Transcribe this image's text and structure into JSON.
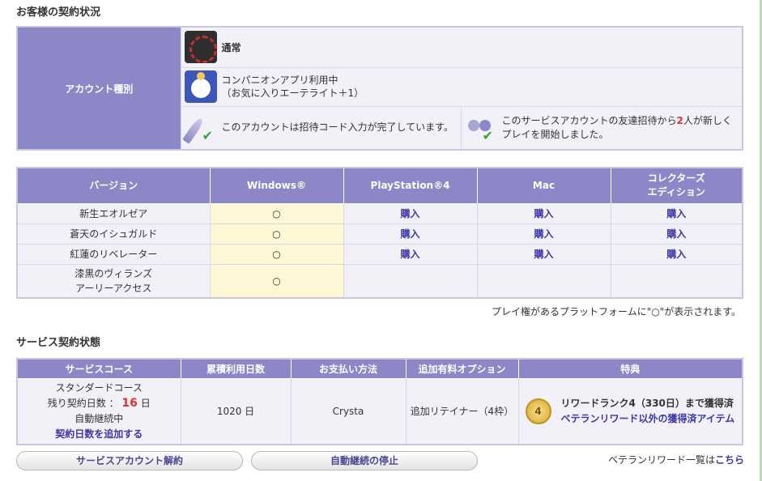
{
  "heading1": "お客様の契約状況",
  "account": {
    "header": "アカウント種別",
    "type_label": "通常",
    "companion_line1": "コンパニオンアプリ利用中",
    "companion_line2": "（お気に入りエーテライト＋1）",
    "invite_text": "このアカウントは招待コード入力が完了しています。",
    "friend_pre": "このサービスアカウントの友達招待から",
    "friend_count": "2",
    "friend_post": "人が新しくプレイを開始しました。"
  },
  "versions": {
    "headers": [
      "バージョン",
      "Windows®",
      "PlayStation®4",
      "Mac",
      "コレクターズ\nエディション"
    ],
    "rows": [
      {
        "name": "新生エオルゼア",
        "windows": "○",
        "ps4": "購入",
        "mac": "購入",
        "ce": "購入"
      },
      {
        "name": "蒼天のイシュガルド",
        "windows": "○",
        "ps4": "購入",
        "mac": "購入",
        "ce": "購入"
      },
      {
        "name": "紅蓮のリベレーター",
        "windows": "○",
        "ps4": "購入",
        "mac": "購入",
        "ce": "購入"
      },
      {
        "name": "漆黒のヴィランズ\nアーリーアクセス",
        "windows": "○",
        "ps4": "",
        "mac": "",
        "ce": ""
      }
    ],
    "note": "プレイ権があるプラットフォームに\"○\"が表示されます。"
  },
  "heading2": "サービス契約状態",
  "service": {
    "headers": [
      "サービスコース",
      "累積利用日数",
      "お支払い方法",
      "追加有料オプション",
      "特典"
    ],
    "course": "スタンダードコース",
    "remaining_label": "残り契約日数 ：",
    "remaining_days": "16",
    "remaining_unit": "日",
    "auto_renew": "自動継続中",
    "add_days_link": "契約日数を追加する",
    "total_days": "1020 日",
    "payment": "Crysta",
    "option": "追加リテイナー（4枠）",
    "medal_number": "4",
    "reward_rank": "リワードランク4（330日）まで獲得済",
    "reward_link": "ベテランリワード以外の獲得済アイテム"
  },
  "buttons": {
    "cancel_account": "サービスアカウント解約",
    "stop_auto": "自動継続の停止"
  },
  "veteran": {
    "text": "ベテランリワード一覧は",
    "link": "こちら"
  }
}
